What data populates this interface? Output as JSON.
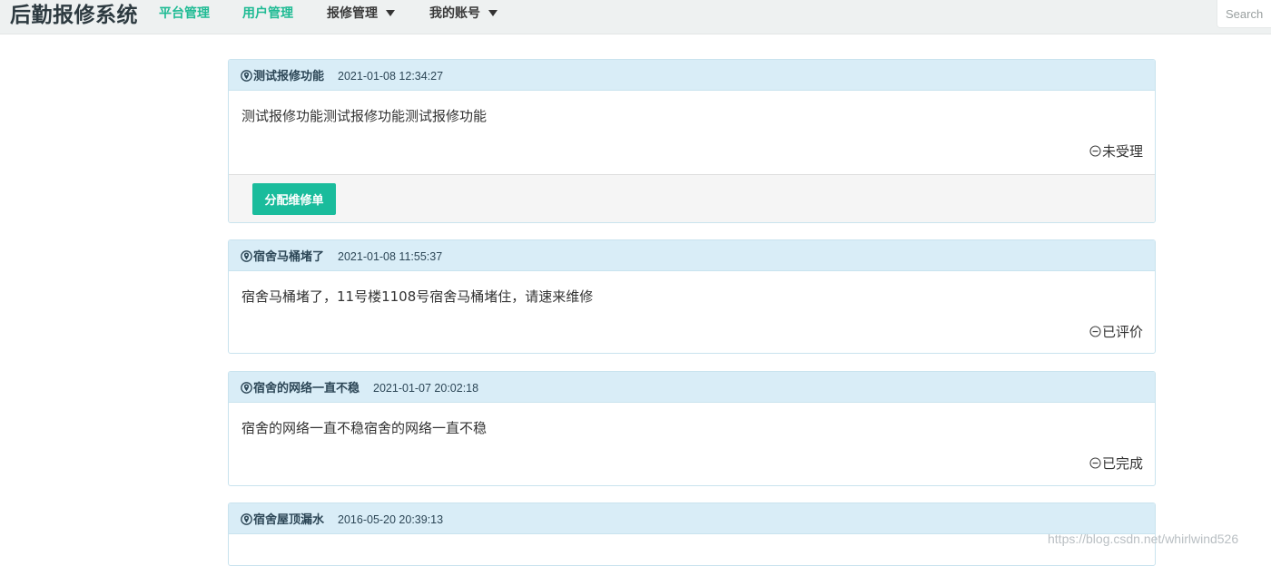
{
  "navbar": {
    "brand": "后勤报修系统",
    "items": [
      {
        "label": "平台管理"
      },
      {
        "label": "用户管理"
      },
      {
        "label": "报修管理"
      },
      {
        "label": "我的账号"
      }
    ],
    "search_placeholder": "Search"
  },
  "repairs": [
    {
      "title": "测试报修功能",
      "time": "2021-01-08 12:34:27",
      "content": "测试报修功能测试报修功能测试报修功能",
      "status": "未受理",
      "action_label": "分配维修单"
    },
    {
      "title": "宿舍马桶堵了",
      "time": "2021-01-08 11:55:37",
      "content": "宿舍马桶堵了，11号楼1108号宿舍马桶堵住，请速来维修",
      "status": "已评价"
    },
    {
      "title": "宿舍的网络一直不稳",
      "time": "2021-01-07 20:02:18",
      "content": "宿舍的网络一直不稳宿舍的网络一直不稳",
      "status": "已完成"
    },
    {
      "title": "宿舍屋顶漏水",
      "time": "2016-05-20 20:39:13"
    }
  ],
  "watermark": "https://blog.csdn.net/whirlwind526",
  "colors": {
    "accent": "#1abc9c",
    "nav_green": "#1fbb94",
    "panel_heading_bg": "#d9edf7",
    "panel_border": "#c9e3ee"
  },
  "icons": {
    "title_icon": "map-marker-circle-icon",
    "status_icon": "minus-circle-icon",
    "nav_caret": "caret-down-icon"
  }
}
